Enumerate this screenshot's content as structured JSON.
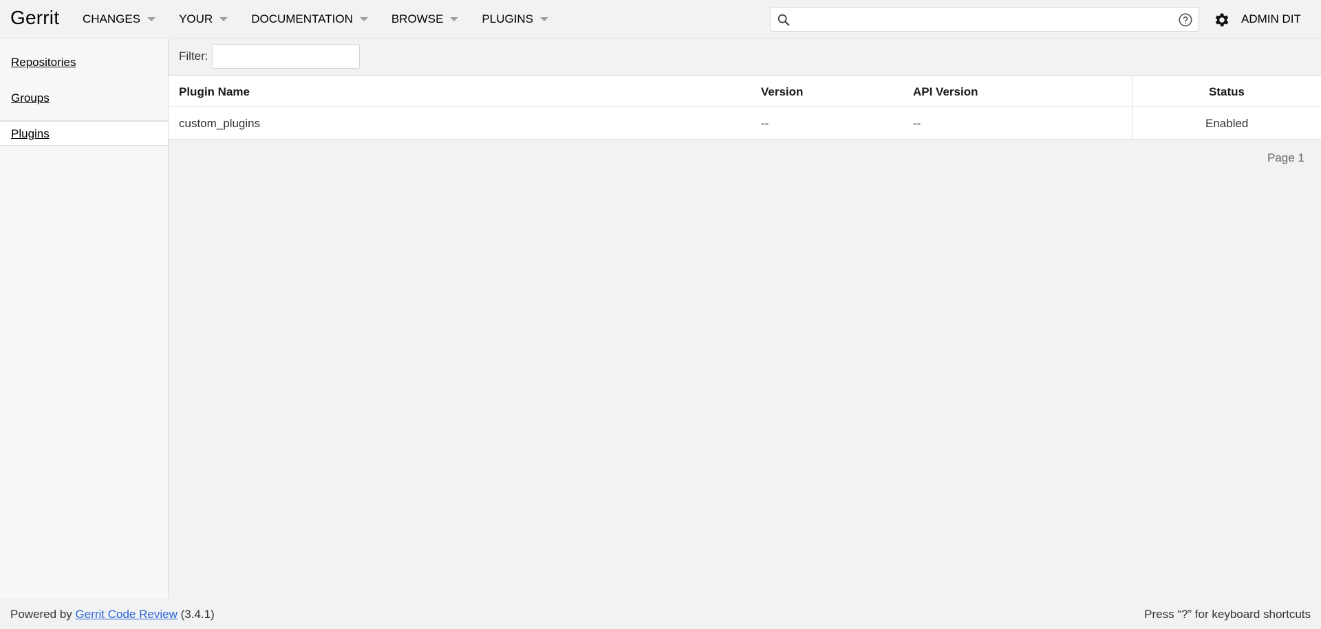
{
  "header": {
    "logo": "Gerrit",
    "nav": [
      {
        "label": "CHANGES"
      },
      {
        "label": "YOUR"
      },
      {
        "label": "DOCUMENTATION"
      },
      {
        "label": "BROWSE"
      },
      {
        "label": "PLUGINS"
      }
    ],
    "search": {
      "value": "",
      "placeholder": ""
    },
    "account": "ADMIN DIT"
  },
  "sidebar": {
    "items": [
      {
        "label": "Repositories"
      },
      {
        "label": "Groups"
      },
      {
        "label": "Plugins",
        "selected": true
      }
    ]
  },
  "main": {
    "filter_label": "Filter:",
    "filter_value": "",
    "table": {
      "headers": [
        "Plugin Name",
        "Version",
        "API Version",
        "Status"
      ],
      "rows": [
        [
          "custom_plugins",
          "--",
          "--",
          "Enabled"
        ]
      ]
    },
    "page_label": "Page 1"
  },
  "footer": {
    "powered_by": "Powered by",
    "link_text": "Gerrit Code Review",
    "version": "(3.4.1)",
    "shortcuts": "Press “?” for keyboard shortcuts"
  },
  "colors": {
    "link": "#2a66d9",
    "background": "#f1f2f3"
  }
}
